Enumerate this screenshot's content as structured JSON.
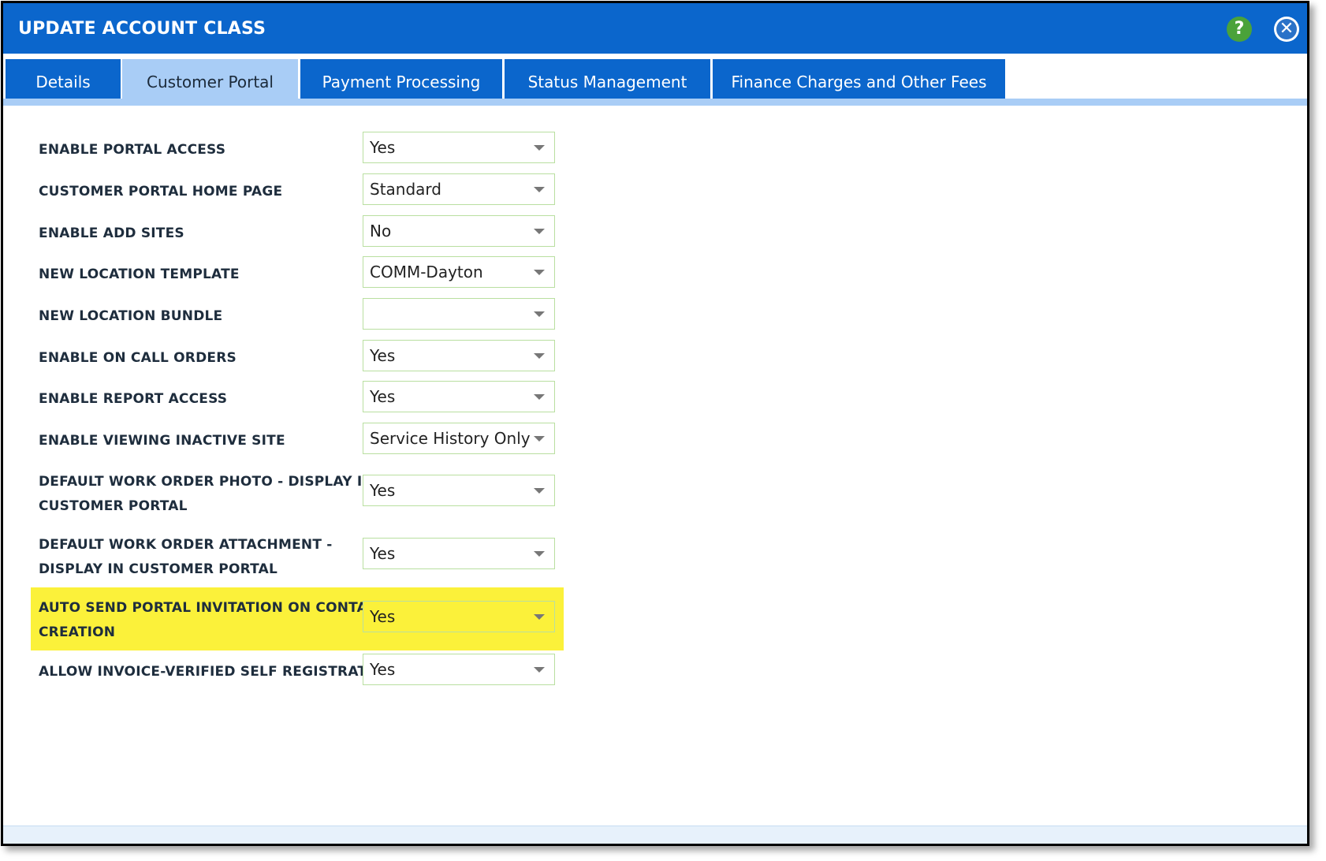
{
  "dialog": {
    "title": "UPDATE ACCOUNT CLASS",
    "help_icon_glyph": "?",
    "close_icon_glyph": "✕"
  },
  "tabs": [
    {
      "label": "Details",
      "active": false
    },
    {
      "label": "Customer Portal",
      "active": true
    },
    {
      "label": "Payment Processing",
      "active": false
    },
    {
      "label": "Status Management",
      "active": false
    },
    {
      "label": "Finance Charges and Other Fees",
      "active": false
    }
  ],
  "fields": [
    {
      "label": "ENABLE PORTAL ACCESS",
      "value": "Yes"
    },
    {
      "label": "CUSTOMER PORTAL HOME PAGE",
      "value": "Standard"
    },
    {
      "label": "ENABLE ADD SITES",
      "value": "No"
    },
    {
      "label": "NEW LOCATION TEMPLATE",
      "value": "COMM-Dayton"
    },
    {
      "label": "NEW LOCATION BUNDLE",
      "value": ""
    },
    {
      "label": "ENABLE ON CALL ORDERS",
      "value": "Yes"
    },
    {
      "label": "ENABLE REPORT ACCESS",
      "value": "Yes"
    },
    {
      "label": "ENABLE VIEWING INACTIVE SITE",
      "value": "Service History Only"
    },
    {
      "label_line1": "DEFAULT WORK ORDER PHOTO - DISPLAY IN",
      "label_line2": "CUSTOMER PORTAL",
      "value": "Yes"
    },
    {
      "label_line1": "DEFAULT WORK ORDER ATTACHMENT -",
      "label_line2": "DISPLAY IN CUSTOMER PORTAL",
      "value": "Yes"
    },
    {
      "label_line1": "AUTO SEND PORTAL INVITATION ON CONTACT",
      "label_line2": "CREATION",
      "value": "Yes",
      "highlighted": true
    },
    {
      "label": "ALLOW INVOICE-VERIFIED SELF REGISTRATION",
      "value": "Yes"
    }
  ],
  "colors": {
    "titlebar": "#0b66cc",
    "active_tab": "#a9cdf6",
    "highlight": "#fbf13a",
    "help_button": "#4aa23a"
  }
}
